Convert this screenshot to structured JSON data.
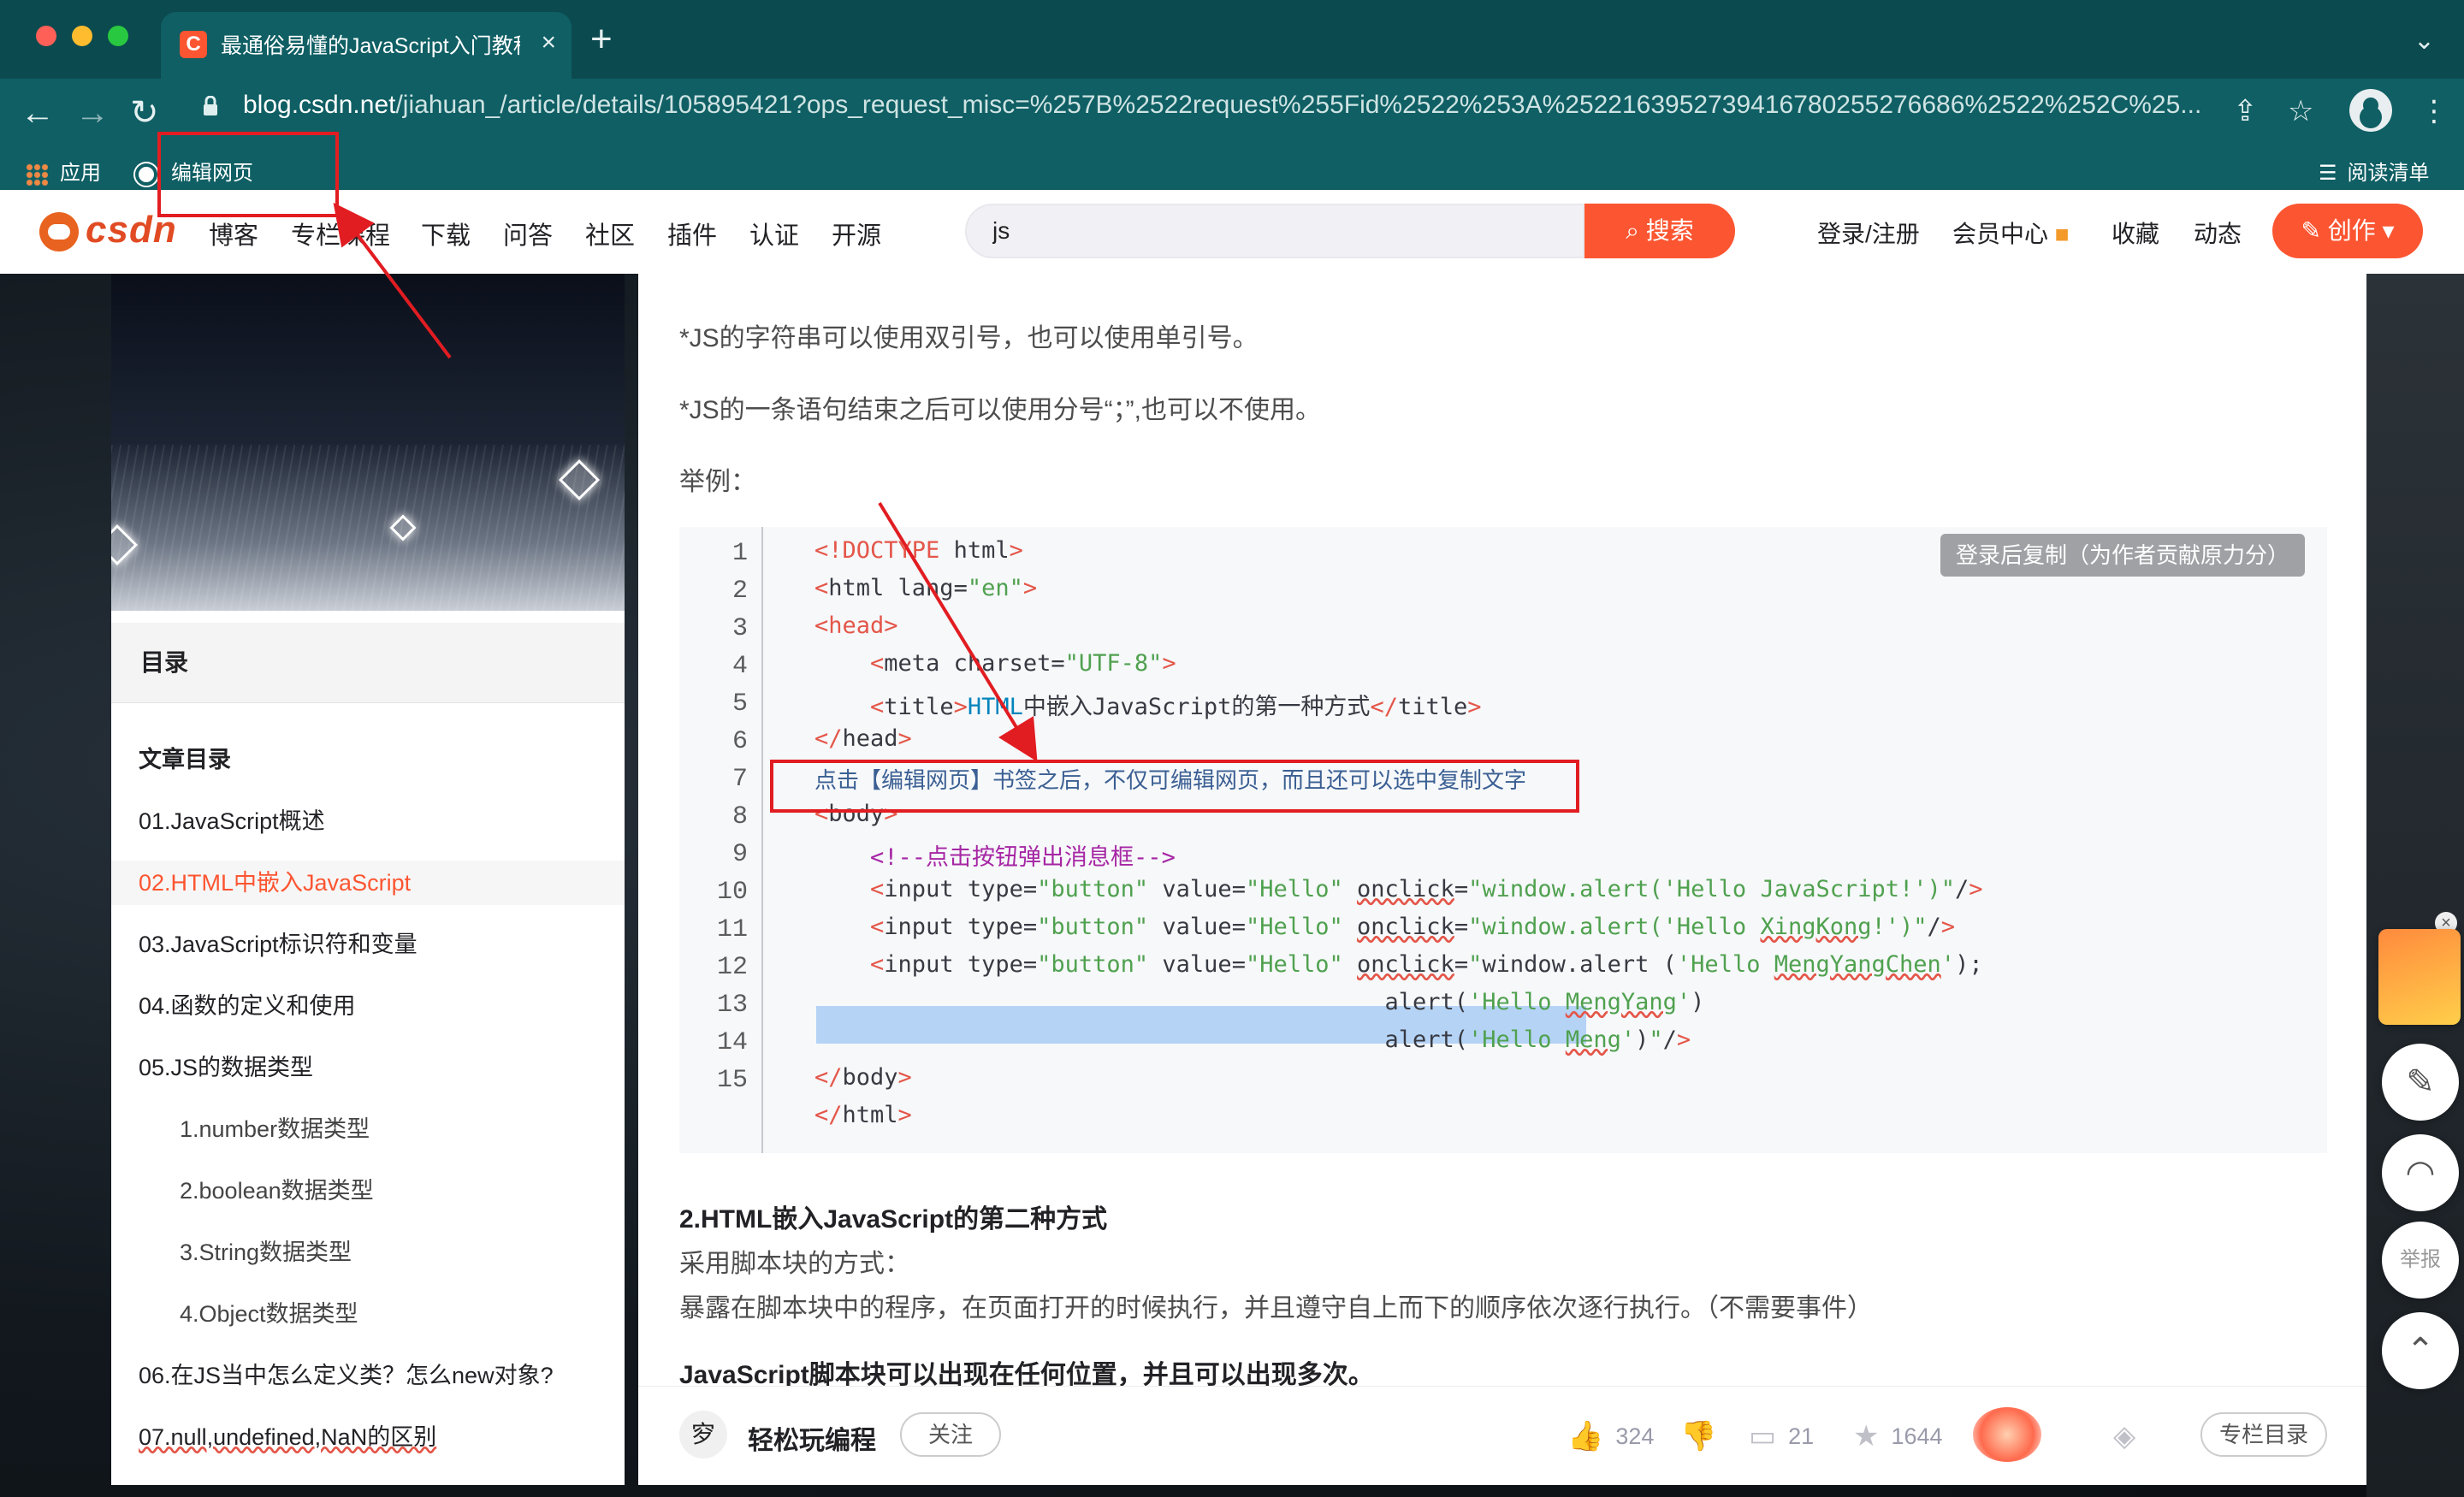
{
  "browser": {
    "tab_title": "最通俗易懂的JavaScript入门教程",
    "tab_favicon": "C",
    "tab_close": "×",
    "new_tab": "+",
    "tab_menu": "⌄",
    "url_domain": "blog.csdn.net",
    "url_path": "/jiahuan_/article/details/105895421?ops_request_misc=%257B%2522request%255Fid%2522%253A%2522163952739416780255276686%2522%252C%25...",
    "bookmarks": {
      "apps": "应用",
      "edit_page": "编辑网页",
      "reading_list": "阅读清单"
    },
    "icons": {
      "back": "←",
      "forward": "→",
      "reload": "↻",
      "share": "⇪",
      "star": "☆",
      "menu": "⋮",
      "reading": "☰"
    },
    "colors": {
      "chrome_bg": "#0f5f64",
      "tab_bg": "#0b4a4f"
    }
  },
  "csdn": {
    "logo": "csdn",
    "nav": [
      "博客",
      "专栏课程",
      "下载",
      "问答",
      "社区",
      "插件",
      "认证",
      "开源"
    ],
    "search": {
      "value": "js",
      "button": "搜索"
    },
    "right": {
      "login": "登录/注册",
      "vip": "会员中心",
      "favorites": "收藏",
      "dynamic": "动态",
      "create": "创作"
    },
    "colors": {
      "brand": "#fc5531"
    }
  },
  "toc": {
    "header": "目录",
    "title": "文章目录",
    "items": [
      {
        "label": "01.JavaScript概述"
      },
      {
        "label": "02.HTML中嵌入JavaScript"
      },
      {
        "label": "03.JavaScript标识符和变量"
      },
      {
        "label": "04.函数的定义和使用"
      },
      {
        "label": "05.JS的数据类型"
      },
      {
        "label": "1.number数据类型"
      },
      {
        "label": "2.boolean数据类型"
      },
      {
        "label": "3.String数据类型"
      },
      {
        "label": "4.Object数据类型"
      },
      {
        "label": "06.在JS当中怎么定义类？怎么new对象?"
      },
      {
        "label": "07.null,undefined,NaN的区别"
      }
    ]
  },
  "article": {
    "p1": "*JS的字符串可以使用双引号，也可以使用单引号。",
    "p2": "*JS的一条语句结束之后可以使用分号“；”,也可以不使用。",
    "p3": "举例：",
    "copy_button": "登录后复制（为作者贡献原力分）",
    "line_numbers": [
      "1",
      "2",
      "3",
      "4",
      "5",
      "6",
      "7",
      "8",
      "9",
      "10",
      "11",
      "12",
      "13",
      "14",
      "15"
    ],
    "highlighted_line": "点击【编辑网页】书签之后，不仅可编辑网页，而且还可以选中复制文字",
    "h2": "2.HTML嵌入JavaScript的第二种方式",
    "p4": "采用脚本块的方式：",
    "p5": "暴露在脚本块中的程序，在页面打开的时候执行，并且遵守自上而下的顺序依次逐行执行。（不需要事件）",
    "p6": "JavaScript脚本块可以出现在任何位置，并且可以出现多次。"
  },
  "actionbar": {
    "author_avatar": "穸",
    "author": "轻松玩编程",
    "follow": "关注",
    "likes": "324",
    "comments": "21",
    "stars": "1644",
    "column_catalog": "专栏目录"
  },
  "floats": {
    "report": "举报",
    "close": "×"
  }
}
